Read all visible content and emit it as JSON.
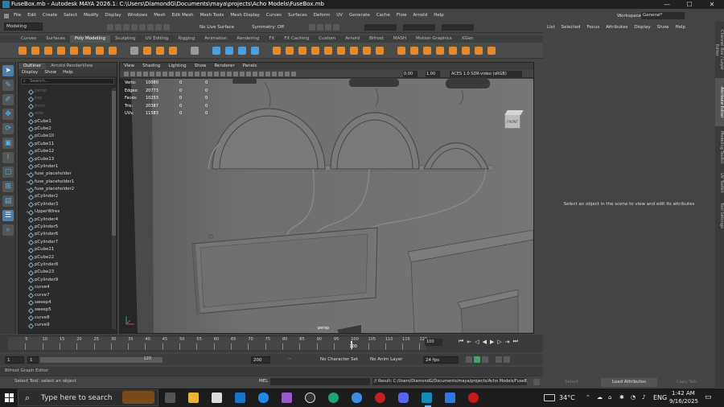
{
  "window": {
    "title": "FuseBox.mb - Autodesk MAYA 2026.1: C:\\Users\\DiamondG\\Documents\\maya\\projects\\Acho Models\\FuseBox.mb",
    "minimize": "—",
    "maximize": "☐",
    "close": "✕"
  },
  "menubar": [
    "File",
    "Edit",
    "Create",
    "Select",
    "Modify",
    "Display",
    "Windows",
    "Mesh",
    "Edit Mesh",
    "Mesh Tools",
    "Mesh Display",
    "Curves",
    "Surfaces",
    "Deform",
    "UV",
    "Generate",
    "Cache",
    "Flow",
    "Arnold",
    "Help"
  ],
  "workspace": {
    "label": "Workspace:",
    "value": "General*"
  },
  "statusline": {
    "mode": "Modeling",
    "live_surface": "No Live Surface",
    "symmetry": "Symmetry: Off"
  },
  "shelf_tabs": [
    "Curves",
    "Surfaces",
    "Poly Modeling",
    "Sculpting",
    "UV Editing",
    "Rigging",
    "Animation",
    "Rendering",
    "FX",
    "FX Caching",
    "Custom",
    "Arnold",
    "Bifrost",
    "MASH",
    "Motion Graphics",
    "XGen"
  ],
  "shelf_active": "Poly Modeling",
  "outliner": {
    "tabs": [
      "Outliner",
      "Arnold RenderView"
    ],
    "menu": [
      "Display",
      "Show",
      "Help"
    ],
    "search_placeholder": "Search...",
    "items": [
      {
        "label": "persp",
        "dim": true,
        "exp": ""
      },
      {
        "label": "top",
        "dim": true,
        "exp": ""
      },
      {
        "label": "front",
        "dim": true,
        "exp": ""
      },
      {
        "label": "side",
        "dim": true,
        "exp": ""
      },
      {
        "label": "pCube1",
        "dim": false,
        "exp": ""
      },
      {
        "label": "pCube2",
        "dim": false,
        "exp": ""
      },
      {
        "label": "pCube10",
        "dim": false,
        "exp": ""
      },
      {
        "label": "pCube11",
        "dim": false,
        "exp": ""
      },
      {
        "label": "pCube12",
        "dim": false,
        "exp": ""
      },
      {
        "label": "pCube13",
        "dim": false,
        "exp": ""
      },
      {
        "label": "pCylinder1",
        "dim": false,
        "exp": ""
      },
      {
        "label": "fuse_placeholder",
        "dim": false,
        "exp": "+"
      },
      {
        "label": "fuse_placeholder1",
        "dim": false,
        "exp": "+"
      },
      {
        "label": "fuse_placeholder2",
        "dim": false,
        "exp": "+"
      },
      {
        "label": "pCylinder2",
        "dim": false,
        "exp": ""
      },
      {
        "label": "pCylinder3",
        "dim": false,
        "exp": ""
      },
      {
        "label": "UpperWires",
        "dim": false,
        "exp": "+"
      },
      {
        "label": "pCylinder4",
        "dim": false,
        "exp": ""
      },
      {
        "label": "pCylinder5",
        "dim": false,
        "exp": ""
      },
      {
        "label": "pCylinder6",
        "dim": false,
        "exp": ""
      },
      {
        "label": "pCylinder7",
        "dim": false,
        "exp": ""
      },
      {
        "label": "pCube21",
        "dim": false,
        "exp": ""
      },
      {
        "label": "pCube22",
        "dim": false,
        "exp": ""
      },
      {
        "label": "pCylinder8",
        "dim": false,
        "exp": ""
      },
      {
        "label": "pCube23",
        "dim": false,
        "exp": ""
      },
      {
        "label": "pCylinder9",
        "dim": false,
        "exp": ""
      },
      {
        "label": "curve4",
        "dim": false,
        "exp": ""
      },
      {
        "label": "curve7",
        "dim": false,
        "exp": ""
      },
      {
        "label": "sweep4",
        "dim": false,
        "exp": ""
      },
      {
        "label": "sweep5",
        "dim": false,
        "exp": ""
      },
      {
        "label": "curve8",
        "dim": false,
        "exp": ""
      },
      {
        "label": "curve9",
        "dim": false,
        "exp": ""
      }
    ]
  },
  "viewport": {
    "menu": [
      "View",
      "Shading",
      "Lighting",
      "Show",
      "Renderer",
      "Panels"
    ],
    "exposure": "0.00",
    "gamma": "1.00",
    "colorspace": "ACES 1.0 SDR-video (sRGB)",
    "camera_label": "persp",
    "viewcube_label": "FRONT",
    "hud": [
      {
        "label": "Verts:",
        "v1": "10080",
        "v2": "0",
        "v3": "0"
      },
      {
        "label": "Edges:",
        "v1": "20773",
        "v2": "0",
        "v3": "0"
      },
      {
        "label": "Faces:",
        "v1": "10253",
        "v2": "0",
        "v3": "0"
      },
      {
        "label": "Tris:",
        "v1": "20387",
        "v2": "0",
        "v3": "0"
      },
      {
        "label": "UVs:",
        "v1": "11583",
        "v2": "0",
        "v3": "0"
      }
    ]
  },
  "attribute_editor": {
    "menu": [
      "List",
      "Selected",
      "Focus",
      "Attributes",
      "Display",
      "Show",
      "Help"
    ],
    "message": "Select an object in the scene to view and edit its attributes",
    "buttons": [
      "Select",
      "Load Attributes",
      "Copy Tab"
    ]
  },
  "right_tabs": [
    "Channel Box / Layer Editor",
    "Attribute Editor",
    "Modeling Toolkit",
    "UV Toolkit",
    "Tool Settings"
  ],
  "timeslider": {
    "ticks": [
      "5",
      "10",
      "15",
      "20",
      "25",
      "30",
      "35",
      "40",
      "45",
      "50",
      "55",
      "60",
      "65",
      "70",
      "75",
      "80",
      "85",
      "90",
      "95",
      "100",
      "105",
      "110",
      "115",
      "120"
    ],
    "current_frame": "100",
    "frame_field": "100",
    "ts_current_fraction": 0.82
  },
  "rangeslider": {
    "start": "1",
    "range_start": "1",
    "range_end": "120",
    "end": "200",
    "character_set": "No Character Set",
    "anim_layer": "No Anim Layer",
    "fps": "24 fps"
  },
  "bifrost_label": "Bifrost Graph Editor",
  "commandline": {
    "help": "Select Tool: select an object",
    "mel": "MEL",
    "result": "// Result: C:/Users/DiamondG/Documents/maya/projects/Acho Models/FuseBox..."
  },
  "taskbar": {
    "search_placeholder": "Type here to search",
    "weather": "34°C",
    "lang": "ENG",
    "time": "1:42 AM",
    "date": "9/16/2025"
  }
}
